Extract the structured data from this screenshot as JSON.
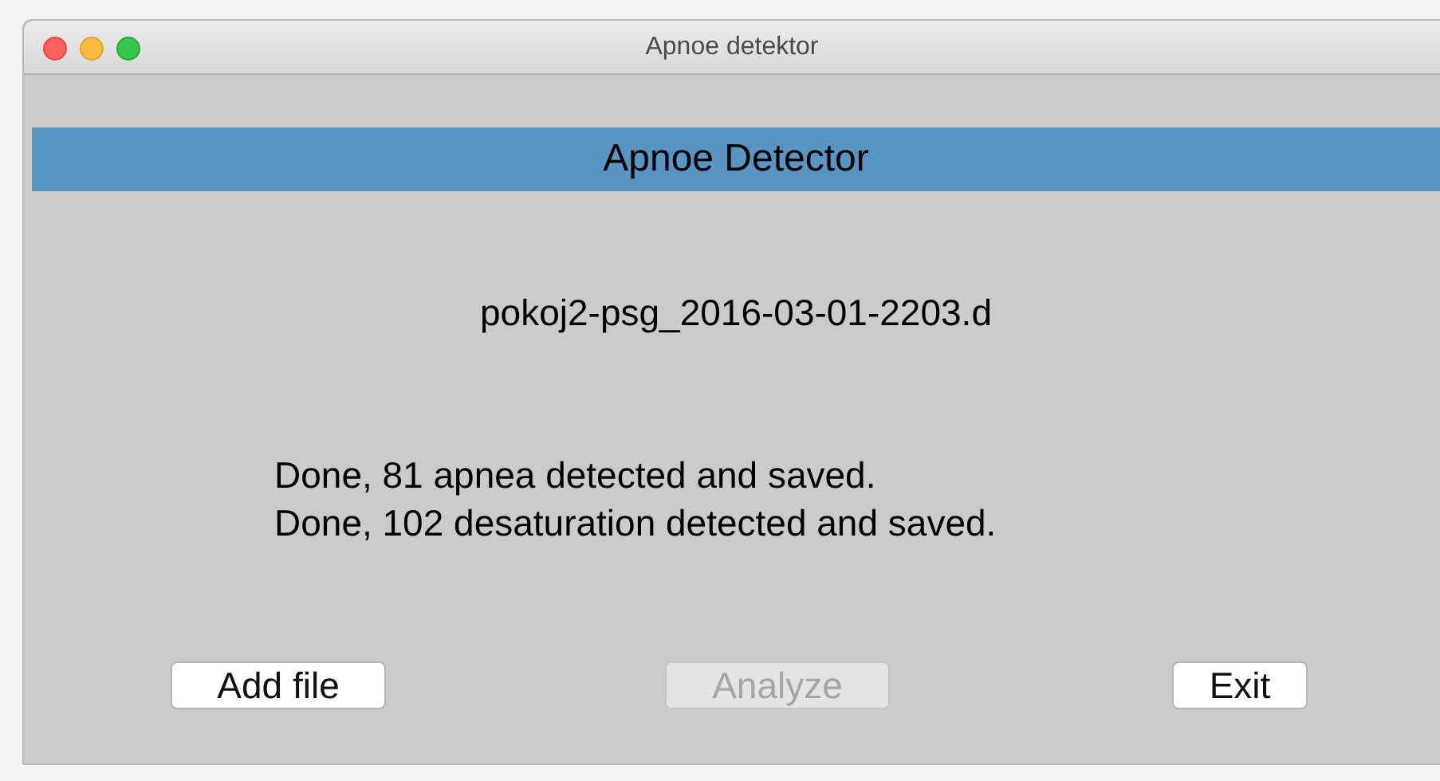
{
  "window": {
    "title": "Apnoe detektor"
  },
  "header": {
    "title": "Apnoe Detector"
  },
  "file_name": "pokoj2-psg_2016-03-01-2203.d",
  "messages": [
    "Done, 81 apnea detected and saved.",
    "Done, 102 desaturation detected and saved."
  ],
  "buttons": [
    {
      "label": "Add file",
      "disabled": false
    },
    {
      "label": "Analyze",
      "disabled": true
    },
    {
      "label": "Exit",
      "disabled": false
    }
  ]
}
